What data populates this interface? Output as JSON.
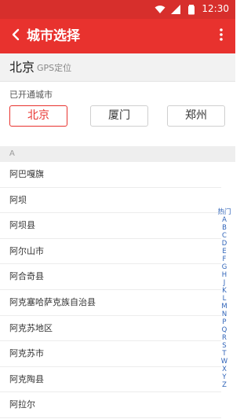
{
  "status_bar": {
    "time": "12:30",
    "icons": [
      "wifi-icon",
      "signal-icon",
      "battery-icon"
    ]
  },
  "app_bar": {
    "title": "城市选择",
    "back_icon": "chevron-left-icon",
    "more_icon": "more-vertical-icon"
  },
  "location": {
    "city": "北京",
    "gps_label": "GPS定位"
  },
  "open_cities": {
    "label": "已开通城市",
    "items": [
      {
        "name": "北京",
        "selected": true
      },
      {
        "name": "厦门",
        "selected": false
      },
      {
        "name": "郑州",
        "selected": false
      }
    ]
  },
  "section": {
    "letter": "A"
  },
  "city_list": [
    "阿巴嘎旗",
    "阿坝",
    "阿坝县",
    "阿尔山市",
    "阿合奇县",
    "阿克塞哈萨克族自治县",
    "阿克苏地区",
    "阿克苏市",
    "阿克陶县",
    "阿拉尔"
  ],
  "index_bar": [
    "热门",
    "A",
    "B",
    "C",
    "D",
    "E",
    "F",
    "G",
    "H",
    "J",
    "K",
    "L",
    "M",
    "N",
    "P",
    "Q",
    "R",
    "S",
    "T",
    "W",
    "X",
    "Y",
    "Z"
  ],
  "colors": {
    "primary": "#e8322e",
    "status_bar": "#d72f2c",
    "index_text": "#2f63b8"
  }
}
